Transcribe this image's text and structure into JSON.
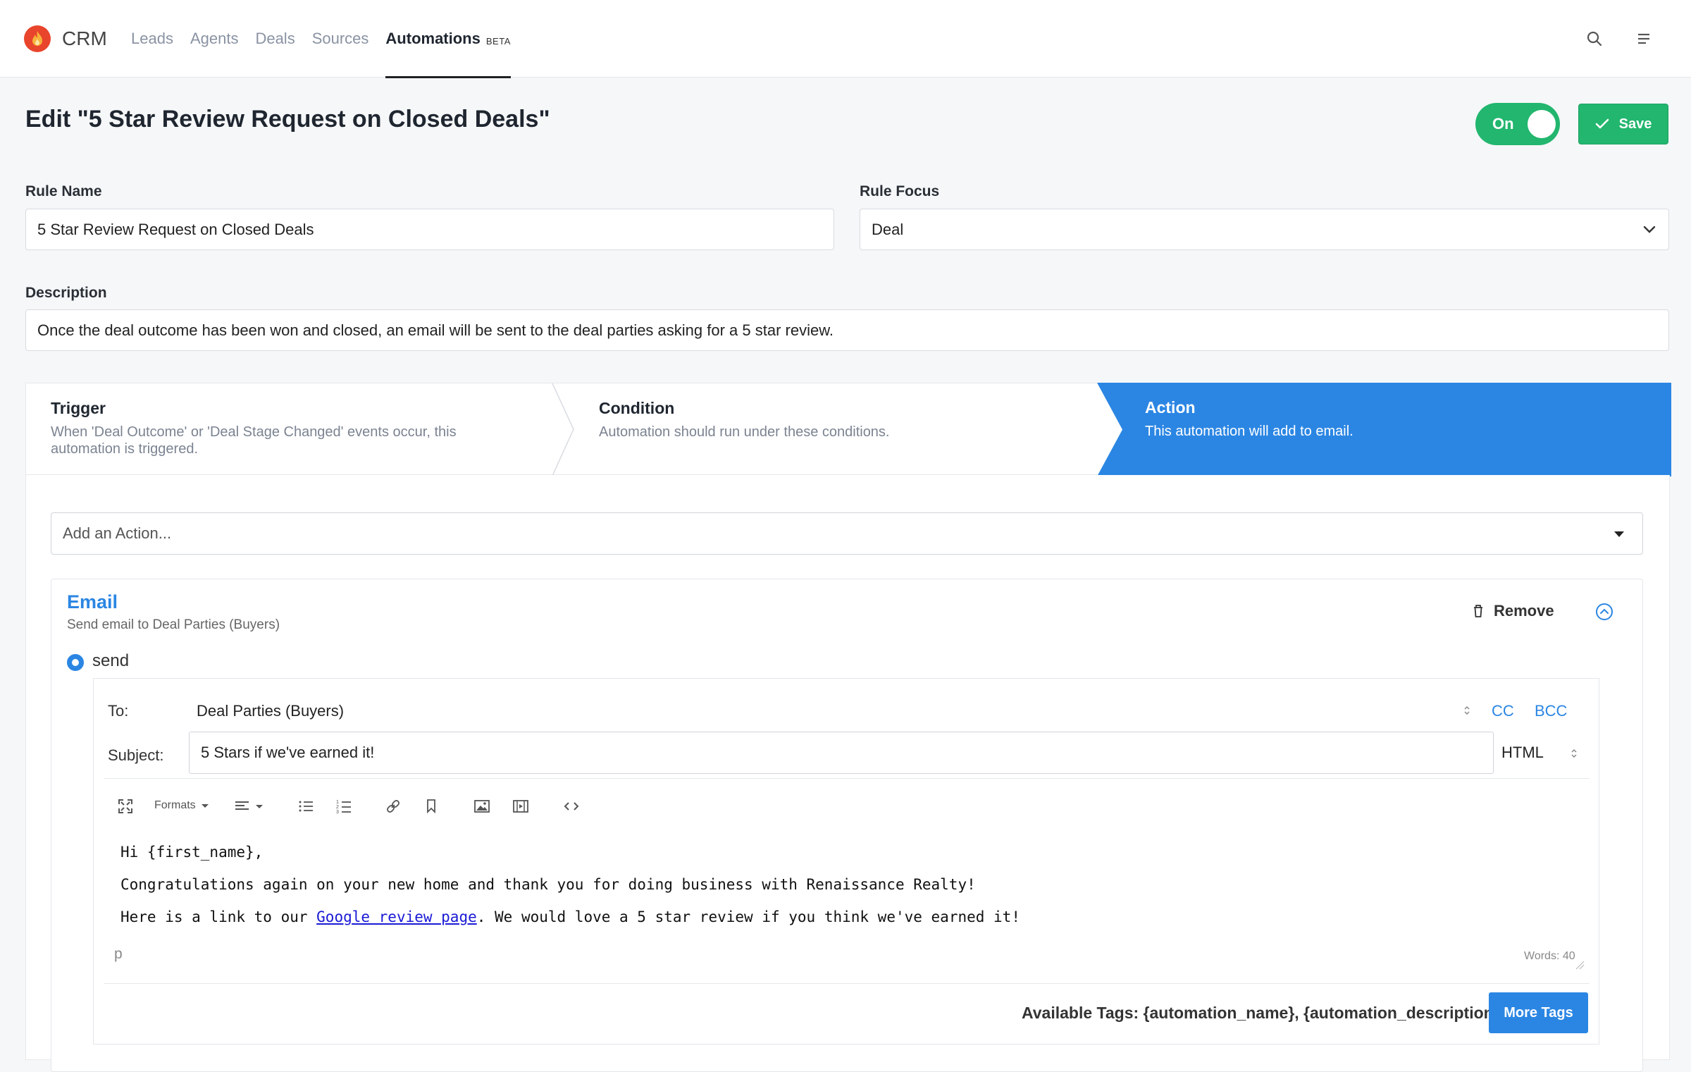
{
  "app": {
    "name": "CRM",
    "logo_icon": "flame-icon",
    "brand_color": "#e8452c"
  },
  "nav": {
    "items": [
      {
        "label": "Leads"
      },
      {
        "label": "Agents"
      },
      {
        "label": "Deals"
      },
      {
        "label": "Sources"
      },
      {
        "label": "Automations",
        "badge": "BETA",
        "active": true
      }
    ]
  },
  "page": {
    "title": "Edit \"5 Star Review Request on Closed Deals\"",
    "toggle_label": "On",
    "toggle_on": true,
    "save_label": "Save"
  },
  "form": {
    "rule_name_label": "Rule Name",
    "rule_name_value": "5 Star Review Request on Closed Deals",
    "rule_focus_label": "Rule Focus",
    "rule_focus_value": "Deal",
    "description_label": "Description",
    "description_value": "Once the deal outcome has been won and closed, an email will be sent to the deal parties asking for a 5 star review."
  },
  "steps": [
    {
      "title": "Trigger",
      "desc_line1": "When 'Deal Outcome' or 'Deal Stage Changed' events occur, this",
      "desc_line2": "automation is triggered."
    },
    {
      "title": "Condition",
      "desc": "Automation should run under these conditions."
    },
    {
      "title": "Action",
      "desc": "This automation will add to email.",
      "active": true
    }
  ],
  "action_panel": {
    "add_action_placeholder": "Add an Action...",
    "email": {
      "title": "Email",
      "subtitle": "Send email to Deal Parties (Buyers)",
      "remove_label": "Remove",
      "radio_label": "send",
      "to_label": "To:",
      "to_value": "Deal Parties (Buyers)",
      "cc_label": "CC",
      "bcc_label": "BCC",
      "subject_label": "Subject:",
      "subject_value": "5 Stars if we've earned it!",
      "format_value": "HTML",
      "toolbar_formats_label": "Formats",
      "body": {
        "line1": "Hi {first_name},",
        "line2": "Congratulations again on your new home and thank you for doing business with Renaissance Realty!",
        "line3_before": "Here is a link to our ",
        "line3_link": "Google review page",
        "line3_after": ". We would love a 5 star review if you think we've earned it!"
      },
      "status_path": "p",
      "word_count": "Words: 40",
      "available_tags": "Available Tags: {automation_name}, {automation_description}",
      "more_tags_label": "More Tags"
    }
  },
  "colors": {
    "accent": "#2b86e3",
    "success": "#22b66e"
  }
}
